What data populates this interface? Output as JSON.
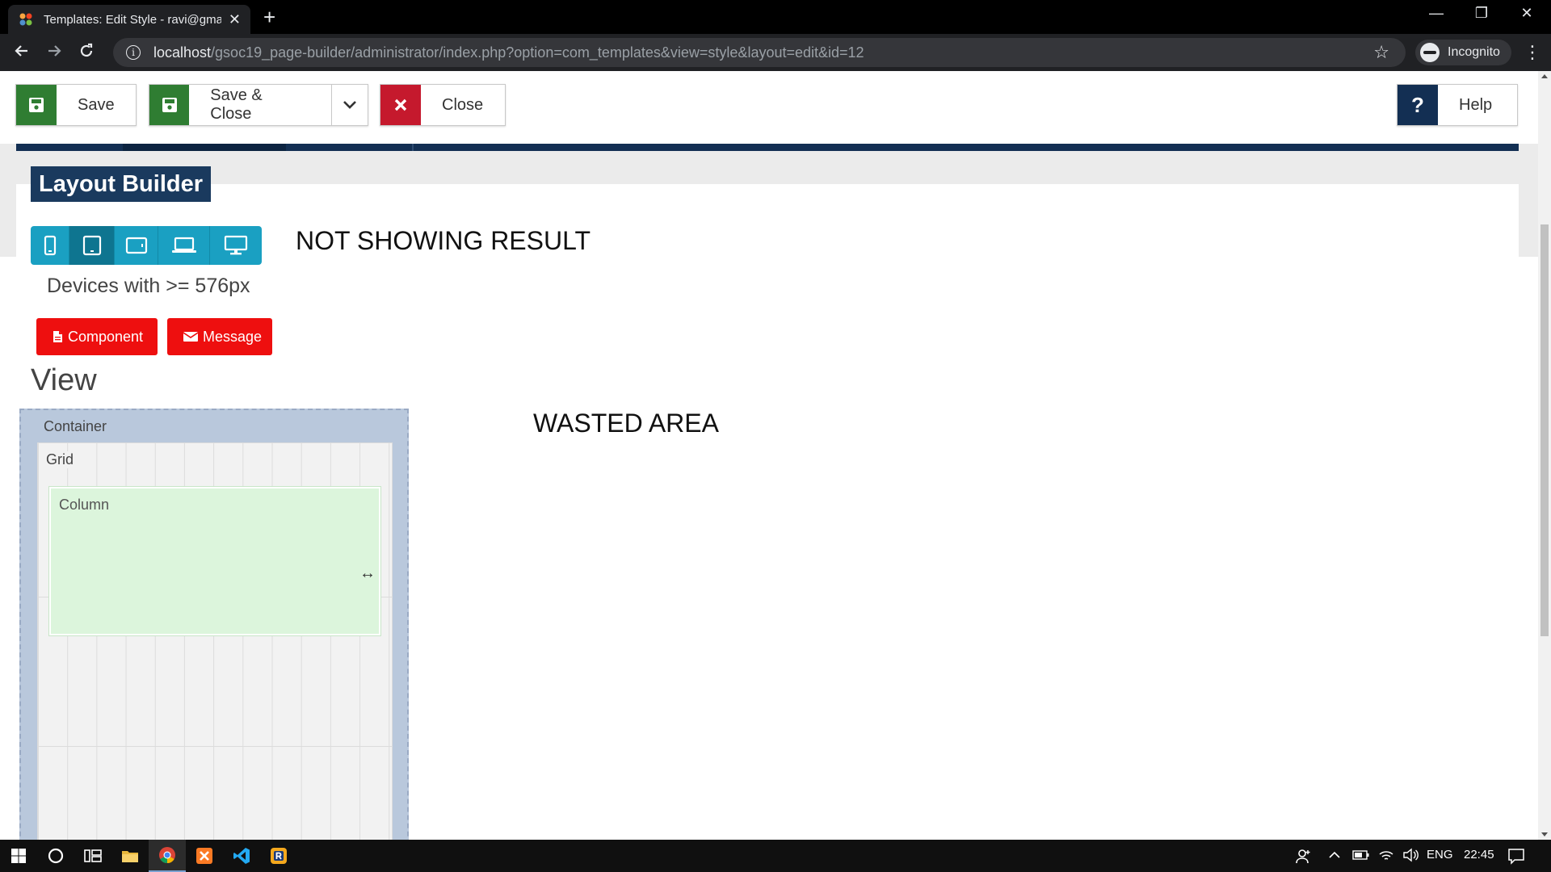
{
  "browser": {
    "tab_title": "Templates: Edit Style - ravi@gma",
    "tab_close": "✕",
    "new_tab": "+",
    "url_host": "localhost",
    "url_path": "/gsoc19_page-builder/administrator/index.php?option=com_templates&view=style&layout=edit&id=12",
    "profile_label": "Incognito",
    "info_glyph": "i",
    "star_glyph": "☆",
    "kebab_glyph": "⋮",
    "minimize_glyph": "—",
    "restore_glyph": "❐",
    "close_glyph": "✕"
  },
  "toolbar": {
    "save_label": "Save",
    "save_close_label": "Save & Close",
    "close_label": "Close",
    "help_label": "Help",
    "help_glyph": "?"
  },
  "page": {
    "title": "Layout Builder",
    "not_showing_note": "NOT SHOWING RESULT",
    "devices_text": "Devices with >= 576px",
    "component_label": "Component",
    "message_label": "Message",
    "view_heading": "View",
    "wasted_note": "WASTED AREA"
  },
  "builder": {
    "container_label": "Container",
    "grid_label": "Grid",
    "column_label": "Column",
    "resize_glyph": "↔"
  },
  "devices": [
    {
      "name": "mobile-portrait-icon",
      "active": false
    },
    {
      "name": "tablet-portrait-icon",
      "active": true
    },
    {
      "name": "tablet-landscape-icon",
      "active": false
    },
    {
      "name": "laptop-icon",
      "active": false
    },
    {
      "name": "desktop-icon",
      "active": false
    }
  ],
  "taskbar": {
    "language": "ENG",
    "time": "22:45"
  },
  "colors": {
    "save_green": "#2f7d32",
    "close_red": "#c5192d",
    "navy": "#132f53",
    "device_teal": "#1aa0c2",
    "action_red": "#ee0f0f",
    "container_blue": "#b9c8dc",
    "column_green": "#dcf5dc"
  }
}
